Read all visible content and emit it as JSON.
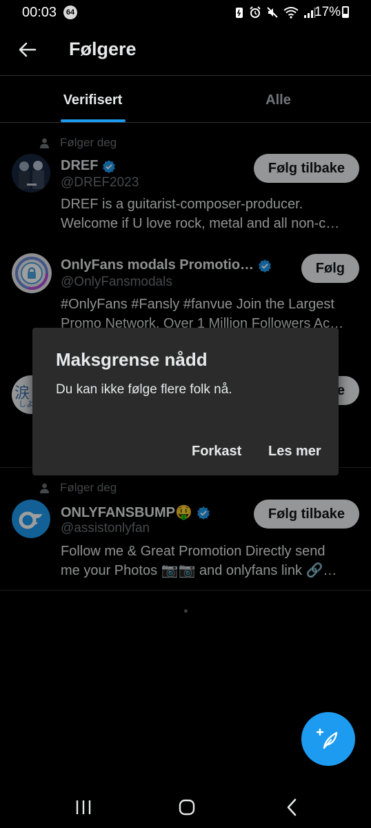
{
  "status_bar": {
    "time": "00:03",
    "notification_count": "64",
    "battery": "17%"
  },
  "header": {
    "title": "Følgere"
  },
  "tabs": [
    {
      "label": "Verifisert",
      "active": true
    },
    {
      "label": "Alle",
      "active": false
    }
  ],
  "users": [
    {
      "follows_you": "Følger deg",
      "name": "DREF",
      "handle": "@DREF2023",
      "verified": true,
      "bio": [
        "DREF is a guitarist-composer-producer.",
        "Welcome if U love rock, metal and all non-c…"
      ],
      "button": "Følg tilbake"
    },
    {
      "name": "OnlyFans modals Promotio…",
      "handle": "@OnlyFansmodals",
      "verified": true,
      "bio": [
        "#OnlyFans #Fansly #fanvue Join the Largest",
        "Promo Network. Over 1 Million Followers Ac…"
      ],
      "button": "Følg"
    },
    {
      "avatar_glyph": "涙",
      "avatar_sub": "しよ",
      "button": "e"
    },
    {
      "follows_you": "Følger deg",
      "name": "ONLYFANSBUMP🤑",
      "handle": "@assistonlyfan",
      "verified": true,
      "bio": [
        "Follow me & Great Promotion Directly send",
        "me your Photos 📷📷 and onlyfans link 🔗…"
      ],
      "button": "Følg tilbake"
    }
  ],
  "dialog": {
    "title": "Maksgrense nådd",
    "message": "Du kan ikke følge flere folk nå.",
    "dismiss": "Forkast",
    "learn_more": "Les mer"
  },
  "colors": {
    "accent": "#1d9bf0",
    "background": "#000000",
    "dialog": "#2b2b2b",
    "muted_text": "#71767b"
  },
  "icons": {
    "back": "arrow-left-icon",
    "verified": "verified-badge-icon",
    "person": "person-icon",
    "compose": "compose-post-icon"
  }
}
